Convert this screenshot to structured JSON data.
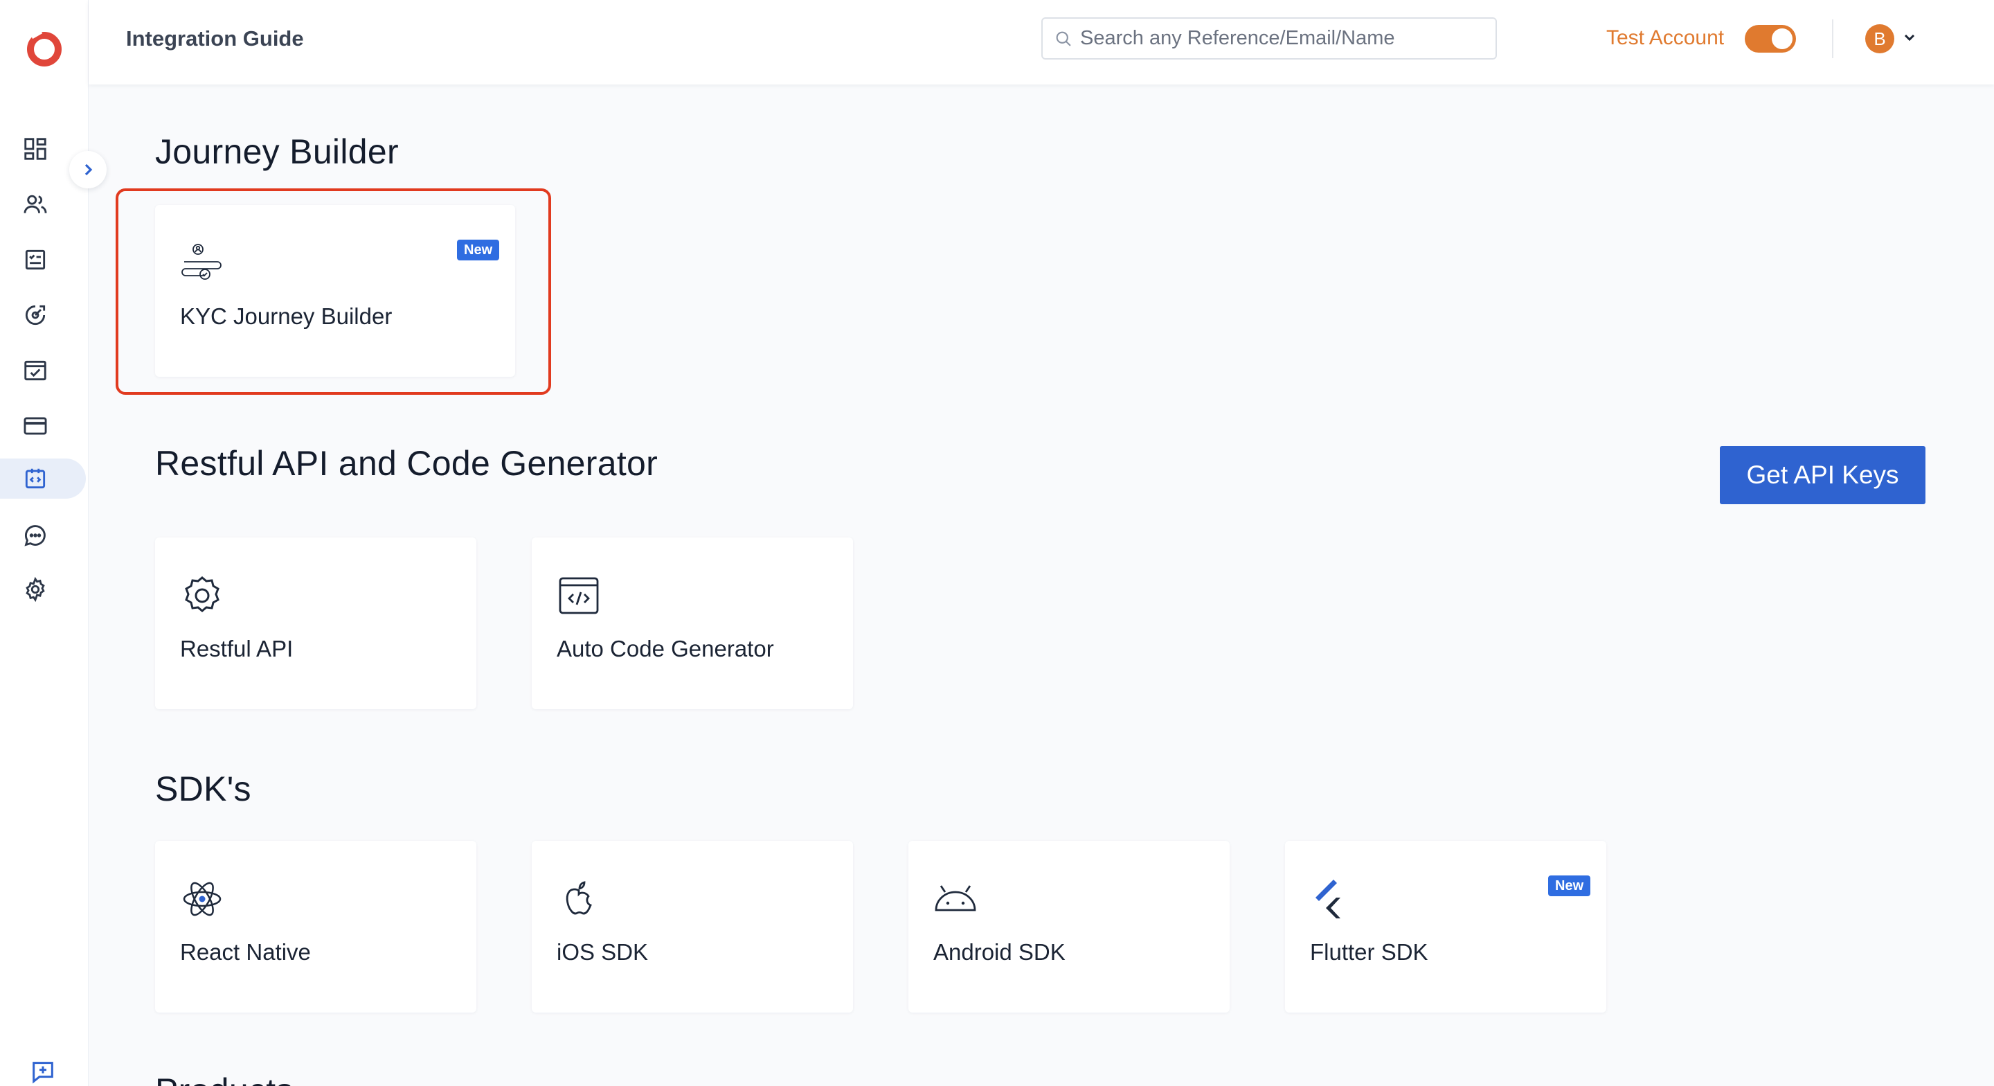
{
  "header": {
    "page_title": "Integration Guide",
    "search_placeholder": "Search any Reference/Email/Name",
    "test_account_label": "Test Account",
    "test_account_enabled": true,
    "avatar_initial": "B"
  },
  "sidebar": {
    "items": [
      {
        "icon": "dashboard-icon"
      },
      {
        "icon": "users-icon"
      },
      {
        "icon": "checklist-icon"
      },
      {
        "icon": "analytics-icon"
      },
      {
        "icon": "calendar-check-icon"
      },
      {
        "icon": "credit-card-icon"
      },
      {
        "icon": "code-icon",
        "active": true
      },
      {
        "icon": "chat-icon"
      },
      {
        "icon": "gear-icon"
      }
    ]
  },
  "sections": {
    "journey": {
      "title": "Journey Builder",
      "cards": [
        {
          "label": "KYC Journey Builder",
          "badge": "New",
          "icon": "journey-icon"
        }
      ]
    },
    "api": {
      "title": "Restful API and Code Generator",
      "button": "Get API Keys",
      "cards": [
        {
          "label": "Restful API",
          "icon": "settings-icon"
        },
        {
          "label": "Auto Code Generator",
          "icon": "code-window-icon"
        }
      ]
    },
    "sdk": {
      "title": "SDK's",
      "cards": [
        {
          "label": "React Native",
          "icon": "react-icon"
        },
        {
          "label": "iOS SDK",
          "icon": "apple-icon"
        },
        {
          "label": "Android SDK",
          "icon": "android-icon"
        },
        {
          "label": "Flutter SDK",
          "badge": "New",
          "icon": "flutter-icon"
        }
      ]
    },
    "products": {
      "title": "Products"
    }
  },
  "colors": {
    "accent": "#2f63d0",
    "orange": "#e07a2f",
    "highlight": "#e13a1f",
    "badge": "#2f6de1"
  }
}
